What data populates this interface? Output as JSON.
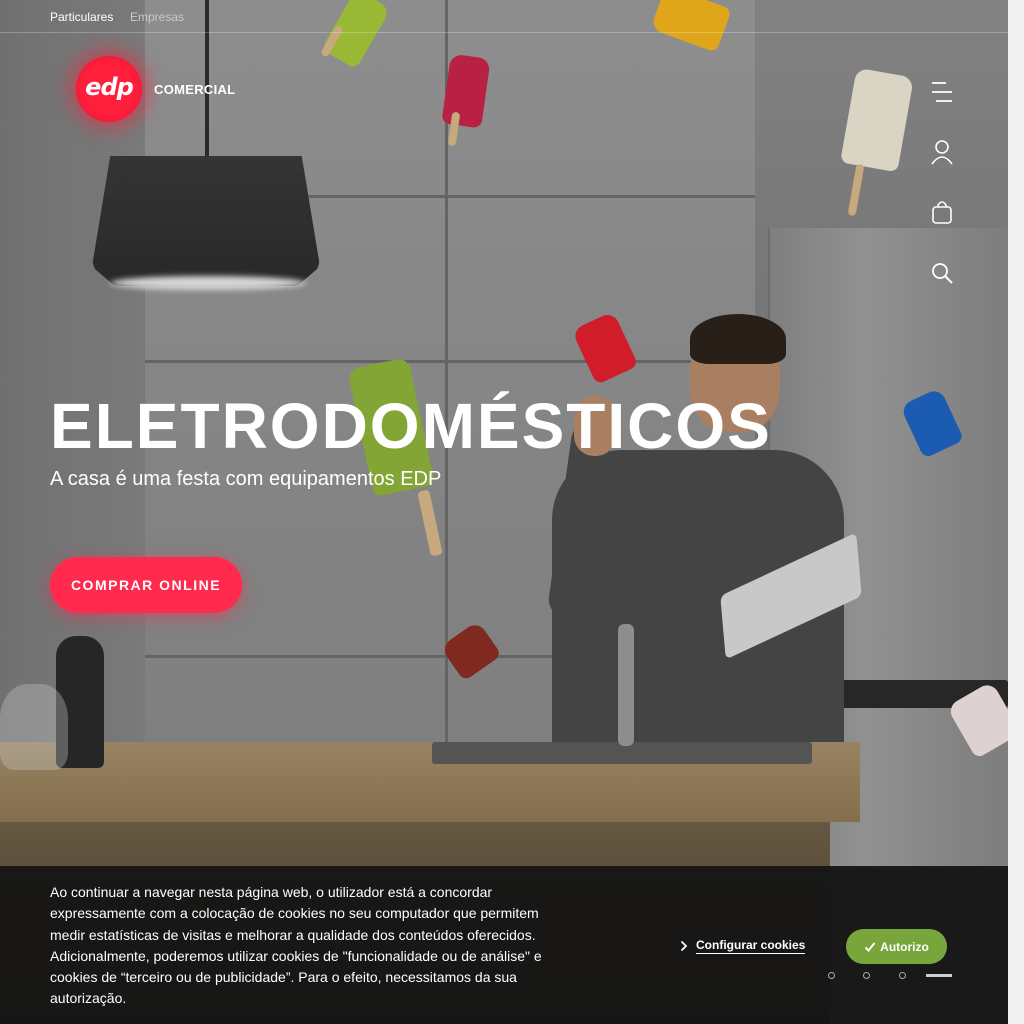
{
  "topbar": {
    "particulares": "Particulares",
    "empresas": "Empresas"
  },
  "brand": {
    "logo_text": "edp",
    "sub_label": "COMERCIAL",
    "accent_color": "#ff1f3d"
  },
  "nav_icons": [
    "menu-icon",
    "user-icon",
    "shopping-bag-icon",
    "search-icon"
  ],
  "hero": {
    "title": "ELETRODOMÉSTICOS",
    "subtitle": "A casa é uma festa com equipamentos EDP",
    "cta_label": "COMPRAR ONLINE",
    "cta_color": "#ff2a4e"
  },
  "cookie_banner": {
    "text": "Ao continuar a navegar nesta página web, o utilizador está a concordar expressamente com a colocação de cookies no seu computador que permitem medir estatísticas de visitas e melhorar a qualidade dos conteúdos oferecidos. Adicionalmente, poderemos utilizar cookies de \"funcionalidade ou de análise\" e cookies de “terceiro ou de publicidade”. Para o efeito, necessitamos da sua autorização.",
    "configure_label": "Configurar cookies",
    "accept_label": "Autorizo",
    "accept_color": "#79a63b"
  },
  "carousel": {
    "slides": 4,
    "active_index": 3
  }
}
